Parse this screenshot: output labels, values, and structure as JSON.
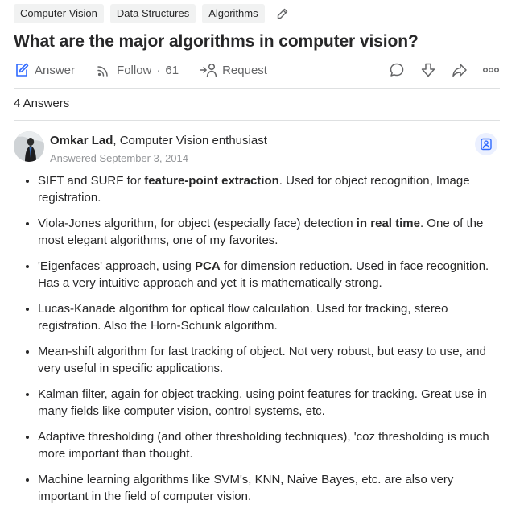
{
  "topics": [
    "Computer Vision",
    "Data Structures",
    "Algorithms"
  ],
  "question": {
    "title": "What are the major algorithms in computer vision?"
  },
  "actions": {
    "answer_label": "Answer",
    "follow_label": "Follow",
    "follow_separator": "·",
    "follow_count": "61",
    "request_label": "Request"
  },
  "answers_count": "4 Answers",
  "answer": {
    "author_name": "Omkar Lad",
    "author_credential": ", Computer Vision enthusiast",
    "answered_date": "Answered September 3, 2014",
    "items": [
      {
        "pre": "SIFT and SURF for ",
        "bold": "feature-point extraction",
        "post": ". Used for object recognition, Image registration."
      },
      {
        "pre": "Viola-Jones algorithm, for object (especially face) detection ",
        "bold": "in real time",
        "post": ". One of the most elegant algorithms, one of my favorites."
      },
      {
        "pre": "'Eigenfaces' approach, using ",
        "bold": "PCA",
        "post": " for dimension reduction. Used in face recognition. Has a very intuitive approach and yet it is mathematically strong."
      },
      {
        "pre": "Lucas-Kanade algorithm for optical flow calculation. Used for tracking, stereo registration. Also the Horn-Schunk algorithm.",
        "bold": "",
        "post": ""
      },
      {
        "pre": "Mean-shift algorithm for fast tracking of object. Not very robust, but easy to use, and very useful in specific applications.",
        "bold": "",
        "post": ""
      },
      {
        "pre": "Kalman filter, again for object tracking, using point features for tracking. Great use in many fields like computer vision, control systems, etc.",
        "bold": "",
        "post": ""
      },
      {
        "pre": "Adaptive thresholding (and other thresholding techniques), 'coz thresholding is much more important than thought.",
        "bold": "",
        "post": ""
      },
      {
        "pre": "Machine learning algorithms like SVM's, KNN, Naive Bayes, etc. are also very important in the field of computer vision.",
        "bold": "",
        "post": ""
      }
    ]
  },
  "icons": {
    "topic_edit": "pencil-icon",
    "answer": "pencil-square-icon",
    "follow": "follow-signal-icon",
    "request": "request-person-icon",
    "comment": "comment-icon",
    "downvote": "downvote-arrow-icon",
    "share": "share-arrow-icon",
    "more": "more-dots-icon",
    "author_follow": "follow-user-icon"
  },
  "colors": {
    "accent": "#2e69ff",
    "text": "#282829",
    "secondary_text": "#636466",
    "meta_text": "#939598",
    "topic_bg": "#f1f2f2",
    "divider": "#dee0e1"
  }
}
